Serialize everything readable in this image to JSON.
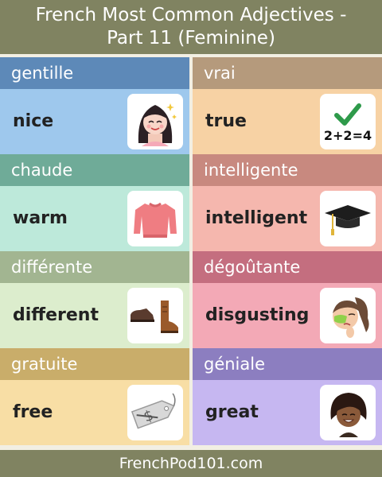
{
  "title": {
    "line1": "French Most Common Adjectives -",
    "line2": "Part 11 (Feminine)"
  },
  "cards": [
    {
      "french": "gentille",
      "english": "nice",
      "icon": "girl-smiling-icon",
      "head_color": "#5d89b8",
      "body_color": "#9ec8ed"
    },
    {
      "french": "vrai",
      "english": "true",
      "icon": "checkmark-equation-icon",
      "head_color": "#b59a7c",
      "body_color": "#f7d2a4"
    },
    {
      "french": "chaude",
      "english": "warm",
      "icon": "sweater-icon",
      "head_color": "#6fab98",
      "body_color": "#bde9da"
    },
    {
      "french": "intelligente",
      "english": "intelligent",
      "icon": "graduation-cap-icon",
      "head_color": "#c8897f",
      "body_color": "#f5b7ae"
    },
    {
      "french": "différente",
      "english": "different",
      "icon": "mismatched-shoes-icon",
      "head_color": "#a2b591",
      "body_color": "#dcedcd"
    },
    {
      "french": "dégoûtante",
      "english": "disgusting",
      "icon": "disgusted-woman-icon",
      "head_color": "#c46e7f",
      "body_color": "#f3a9b6"
    },
    {
      "french": "gratuite",
      "english": "free",
      "icon": "price-tag-icon",
      "head_color": "#c9ad6a",
      "body_color": "#f8dea5"
    },
    {
      "french": "géniale",
      "english": "great",
      "icon": "smiling-woman-icon",
      "head_color": "#8c7ec0",
      "body_color": "#c6b7f1"
    }
  ],
  "equation": "2+2=4",
  "footer": "FrenchPod101.com"
}
